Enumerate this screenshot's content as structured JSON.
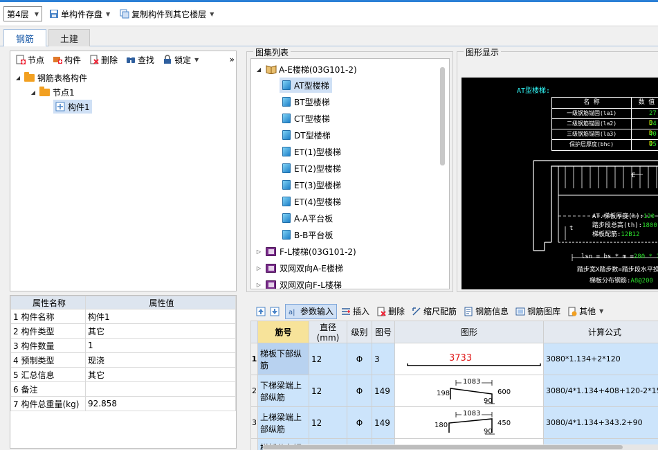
{
  "toolbar": {
    "floor": "第4层",
    "save_single": "单构件存盘",
    "copy_to_floor": "复制构件到其它楼层"
  },
  "tabs": [
    {
      "label": "钢筋",
      "active": true
    },
    {
      "label": "土建",
      "active": false
    }
  ],
  "tree_toolbar": {
    "node": "节点",
    "component": "构件",
    "delete": "删除",
    "find": "查找",
    "lock": "锁定",
    "more": "»"
  },
  "tree": {
    "root": "钢筋表格构件",
    "node1": "节点1",
    "comp1": "构件1"
  },
  "properties": {
    "headers": [
      "属性名称",
      "属性值"
    ],
    "rows": [
      {
        "no": "1",
        "name": "构件名称",
        "value": "构件1"
      },
      {
        "no": "2",
        "name": "构件类型",
        "value": "其它"
      },
      {
        "no": "3",
        "name": "构件数量",
        "value": "1"
      },
      {
        "no": "4",
        "name": "预制类型",
        "value": "现浇"
      },
      {
        "no": "5",
        "name": "汇总信息",
        "value": "其它"
      },
      {
        "no": "6",
        "name": "备注",
        "value": ""
      },
      {
        "no": "7",
        "name": "构件总重量(kg)",
        "value": "92.858"
      }
    ]
  },
  "atlas": {
    "title": "图集列表",
    "group1": "A-E楼梯(03G101-2)",
    "items": [
      "AT型楼梯",
      "BT型楼梯",
      "CT型楼梯",
      "DT型楼梯",
      "ET(1)型楼梯",
      "ET(2)型楼梯",
      "ET(3)型楼梯",
      "ET(4)型楼梯",
      "A-A平台板",
      "B-B平台板"
    ],
    "groups": [
      "F-L楼梯(03G101-2)",
      "双网双向A-E楼梯",
      "双网双向F-L楼梯"
    ]
  },
  "preview": {
    "title": "图形显示",
    "cad_title": "AT型楼梯:",
    "table_headers": [
      "名 称",
      "数 值"
    ],
    "table_rows": [
      {
        "name": "一级钢筋锚固(la1)",
        "value": "27",
        "unit": "D"
      },
      {
        "name": "二级钢筋锚固(la2)",
        "value": "34",
        "unit": "D"
      },
      {
        "name": "三级钢筋锚固(la3)",
        "value": "40",
        "unit": "D"
      },
      {
        "name": "保护层厚度(bhc)",
        "value": "15",
        "unit": ""
      }
    ],
    "info1_label": "AT.梯板厚度(h):",
    "info1_value": "120",
    "info2_label": "踏步段总高(th):",
    "info2_value": "1800",
    "info3_label": "梯板配筋:",
    "info3_value": "12B12",
    "formula_label": "lsn = bs * m =",
    "formula_value": "280 * 11",
    "note1": "踏步宽X踏步数=踏步段水平投",
    "note2_label": "梯板分布钢筋:",
    "note2_value": "A8@200",
    "mark_e": "E",
    "mark_t": "t"
  },
  "grid_toolbar": {
    "param_input": "参数输入",
    "insert": "插入",
    "delete": "删除",
    "scale": "缩尺配筋",
    "rebar_info": "钢筋信息",
    "rebar_lib": "钢筋图库",
    "other": "其他"
  },
  "grid": {
    "headers": [
      "筋号",
      "直径(mm)",
      "级别",
      "图号",
      "图形",
      "计算公式"
    ],
    "rows": [
      {
        "no": "1",
        "name": "梯板下部纵筋",
        "dia": "12",
        "grade": "Φ",
        "fig": "3",
        "formula": "3080*1.134+2*120",
        "shape_len": "3733"
      },
      {
        "no": "2",
        "name": "下梯梁端上部纵筋",
        "dia": "12",
        "grade": "Φ",
        "fig": "149",
        "formula": "3080/4*1.134+408+120-2*15",
        "d1": "1083",
        "d2": "198",
        "d3": "600",
        "d4": "90"
      },
      {
        "no": "3",
        "name": "上梯梁端上部纵筋",
        "dia": "12",
        "grade": "Φ",
        "fig": "149",
        "formula": "3080/4*1.134+343.2+90",
        "d1": "1083",
        "d2": "180",
        "d3": "450",
        "d4": "90"
      },
      {
        "no": "4",
        "name": "梯板分布钢",
        "dia": "",
        "grade": "",
        "fig": "",
        "formula": ""
      }
    ]
  },
  "colors": {
    "accent": "#2b7fd6",
    "selection": "#cce4fb",
    "cad_green": "#2bdc2b",
    "cad_cyan": "#3ff"
  }
}
